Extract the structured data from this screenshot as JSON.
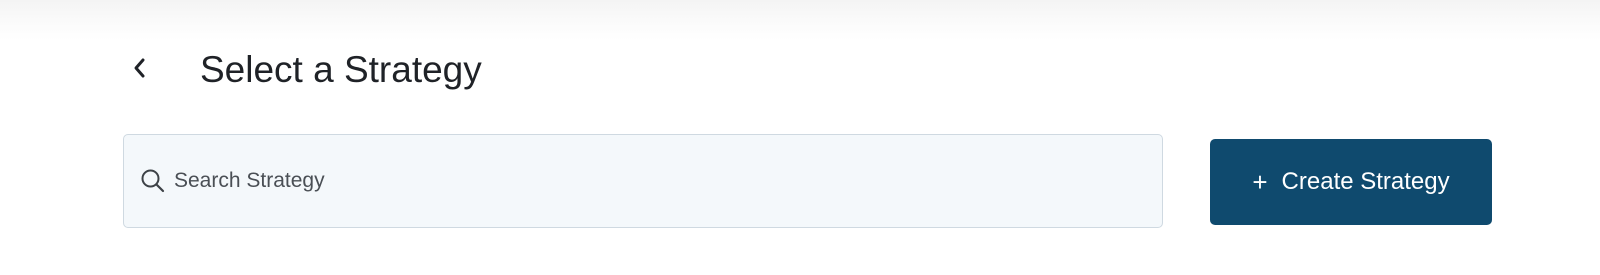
{
  "header": {
    "back_icon": "chevron-left-icon",
    "title": "Select a Strategy"
  },
  "search": {
    "icon": "search-icon",
    "placeholder": "Search Strategy",
    "value": ""
  },
  "actions": {
    "create_icon": "+",
    "create_label": "Create Strategy"
  },
  "colors": {
    "primary": "#0f4a6e",
    "search_background": "#f4f8fb",
    "search_border": "#cfd9e1",
    "title_text": "#1f2227"
  }
}
